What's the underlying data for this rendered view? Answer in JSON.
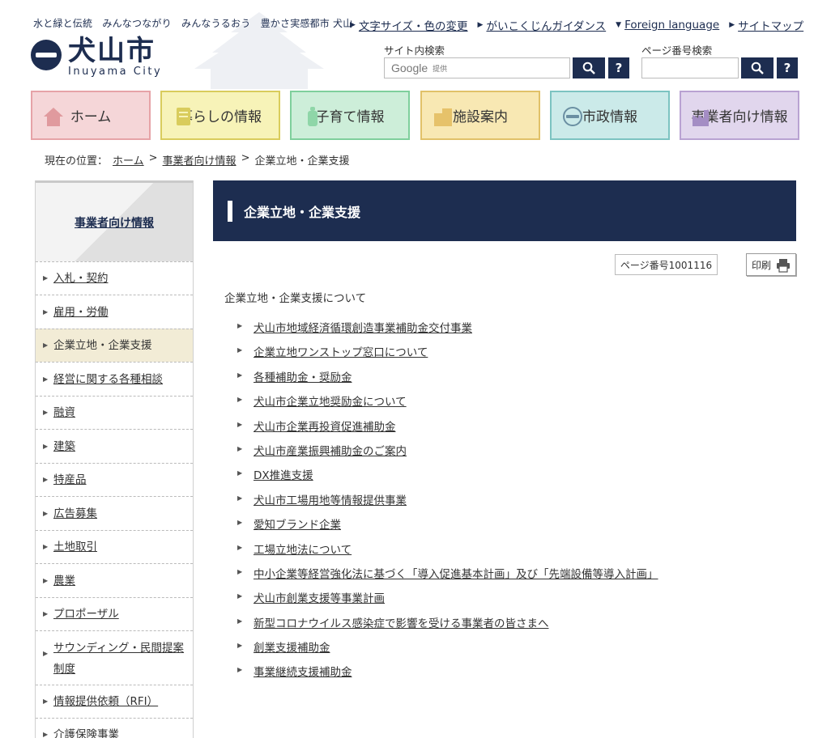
{
  "header": {
    "tagline": "水と緑と伝統　みんなつながり　みんなうるおう　豊かさ実感都市 犬山",
    "logo_jp": "犬山市",
    "logo_en": "Inuyama City",
    "util_links": [
      {
        "label": "文字サイズ・色の変更",
        "marker": "▶"
      },
      {
        "label": "がいこくじんガイダンス",
        "marker": "▶"
      },
      {
        "label": "Foreign language",
        "marker": "▼"
      },
      {
        "label": "サイトマップ",
        "marker": "▶"
      }
    ],
    "site_search": {
      "label": "サイト内検索",
      "brand": "Google",
      "brand_sub": "提供",
      "help": "?"
    },
    "page_search": {
      "label": "ページ番号検索",
      "help": "?"
    }
  },
  "gnav": [
    {
      "label": "ホーム",
      "icon": "house-icon",
      "bg": "#f5d6d8",
      "border": "#e6a3a7"
    },
    {
      "label": "暮らしの情報",
      "icon": "document-icon",
      "bg": "#f7f3b8",
      "border": "#d9cc5c"
    },
    {
      "label": "子育て情報",
      "icon": "baby-bottle-icon",
      "bg": "#cdeed9",
      "border": "#7fcf9c"
    },
    {
      "label": "施設案内",
      "icon": "building-icon",
      "bg": "#f8e8b3",
      "border": "#e1c169"
    },
    {
      "label": "市政情報",
      "icon": "city-emblem-icon",
      "bg": "#cbeae9",
      "border": "#7cc3c1"
    },
    {
      "label": "事業者向け情報",
      "icon": "factory-icon",
      "bg": "#e1d6ed",
      "border": "#b9a2d2"
    }
  ],
  "breadcrumb": {
    "prefix": "現在の位置：",
    "items": [
      "ホーム",
      "事業者向け情報"
    ],
    "current": "企業立地・企業支援",
    "separator": ">"
  },
  "sidebar": {
    "heading": "事業者向け情報",
    "items": [
      {
        "label": "入札・契約"
      },
      {
        "label": "雇用・労働"
      },
      {
        "label": "企業立地・企業支援",
        "active": true
      },
      {
        "label": "経営に関する各種相談"
      },
      {
        "label": "融資"
      },
      {
        "label": "建築"
      },
      {
        "label": "特産品"
      },
      {
        "label": "広告募集"
      },
      {
        "label": "土地取引"
      },
      {
        "label": "農業"
      },
      {
        "label": "プロポーザル"
      },
      {
        "label": "サウンディング・民間提案制度"
      },
      {
        "label": "情報提供依頼（RFI）"
      },
      {
        "label": "介護保険事業"
      }
    ]
  },
  "main": {
    "title": "企業立地・企業支援",
    "page_number": "ページ番号1001116",
    "print_label": "印刷",
    "intro": "企業立地・企業支援について",
    "links": [
      "犬山市地域経済循環創造事業補助金交付事業",
      "企業立地ワンストップ窓口について",
      "各種補助金・奨励金",
      "犬山市企業立地奨励金について",
      "犬山市企業再投資促進補助金",
      "犬山市産業振興補助金のご案内",
      "DX推進支援",
      "犬山市工場用地等情報提供事業",
      "愛知ブランド企業",
      "工場立地法について",
      "中小企業等経営強化法に基づく「導入促進基本計画」及び「先端設備等導入計画」",
      "犬山市創業支援等事業計画",
      "新型コロナウイルス感染症で影響を受ける事業者の皆さまへ",
      "創業支援補助金",
      "事業継続支援補助金"
    ]
  },
  "colors": {
    "navy": "#1d2d50",
    "active_bg": "#f2ecd6"
  }
}
